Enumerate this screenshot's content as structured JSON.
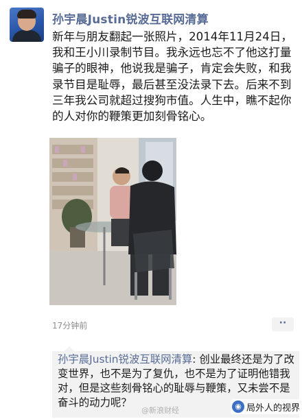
{
  "post": {
    "author": "孙宇晨Justin锐波互联网清算",
    "text": "新年与朋友翻起一张照片，2014年11月24日，我和王小川录制节目。我永远也忘不了他这打量骗子的眼神，他说我是骗子，肯定会失败，和我录节目是耻辱，最后甚至没法录下去。后来不到三年我公司就超过搜狗市值。人生中，瞧不起你的人对你的鞭策更加刻骨铭心。",
    "timestamp": "17分钟前",
    "more_icon": "more-dots-icon"
  },
  "comment": {
    "author": "孙宇晨Justin锐波互联网清算",
    "separator": ": ",
    "text": "创业最终还是为了改变世界，也不是为了复仇，也不是为了证明他错我对，但是这些刻骨铭心的耻辱与鞭策，又未尝不是奋斗的动力呢？"
  },
  "watermarks": {
    "weibo": "@新浪财经",
    "channel": "局外人的视界",
    "channel_icon": "channel-logo-icon"
  },
  "colors": {
    "link": "#576b95",
    "comment_bg": "#f2f2f2",
    "timestamp": "#8c8c8c"
  }
}
